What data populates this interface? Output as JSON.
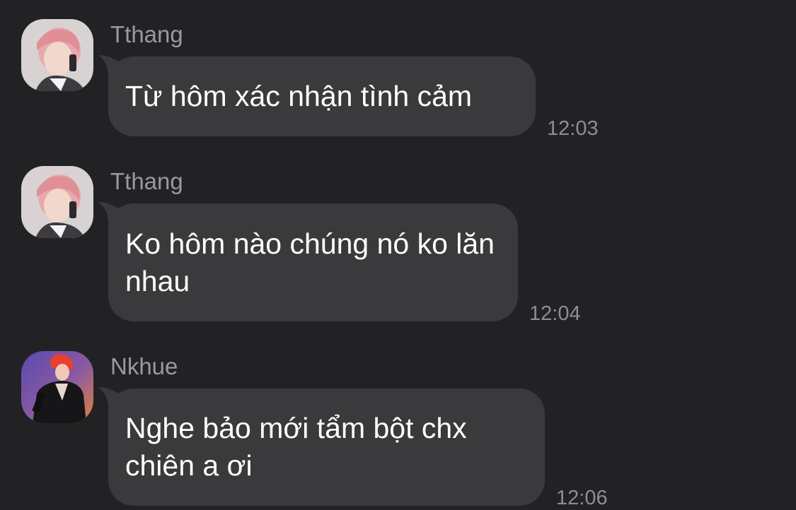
{
  "messages": [
    {
      "sender": "Tthang",
      "text": "Từ hôm xác nhận tình cảm",
      "time": "12:03"
    },
    {
      "sender": "Tthang",
      "text": "Ko hôm nào chúng nó ko lăn nhau",
      "time": "12:04"
    },
    {
      "sender": "Nkhue",
      "text": "Nghe bảo mới tẩm bột chx chiên a ơi",
      "time": "12:06"
    }
  ],
  "colors": {
    "background": "#222224",
    "bubble": "#3a3a3c",
    "message_text": "#ffffff",
    "meta_text": "#9a9a9e"
  }
}
